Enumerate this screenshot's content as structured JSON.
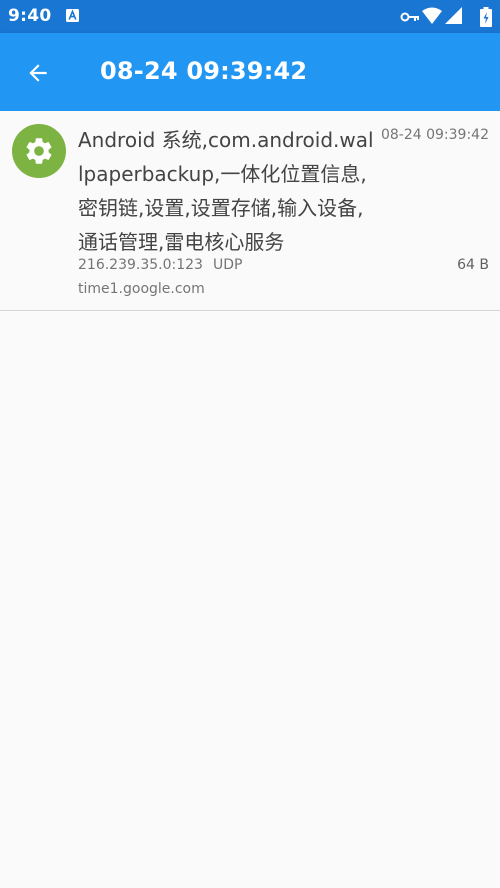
{
  "status_bar": {
    "time": "9:40",
    "icons": [
      "a-notification-icon",
      "vpn-key-icon",
      "wifi-icon",
      "cell-signal-icon",
      "battery-icon"
    ]
  },
  "app_bar": {
    "title": "08-24 09:39:42",
    "back_icon": "arrow-back-icon",
    "color": "#2196f3"
  },
  "entry": {
    "app_icon": "gear-icon",
    "app_icon_color": "#7cb342",
    "apps": "Android 系统,com.android.wallpaperbackup,一体化位置信息,密钥链,设置,设置存储,输入设备,通话管理,雷电核心服务",
    "time": "08-24 09:39:42",
    "address": "216.239.35.0:123",
    "protocol": "UDP",
    "size": "64 B",
    "host": "time1.google.com"
  }
}
